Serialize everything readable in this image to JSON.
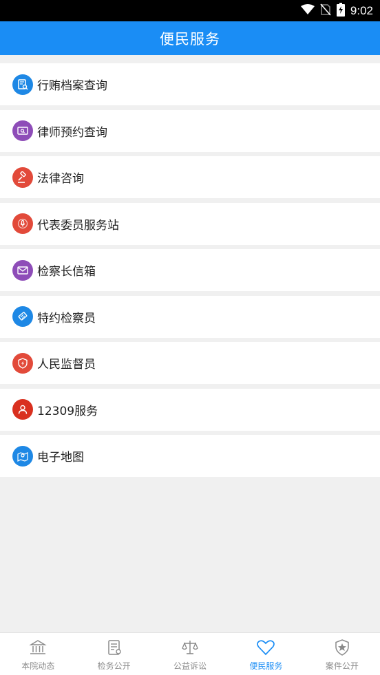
{
  "status_bar": {
    "time": "9:02"
  },
  "header": {
    "title": "便民服务"
  },
  "colors": {
    "accent": "#1a8df5",
    "blue": "#1e88e5",
    "purple": "#8e4db8",
    "red": "#e24a3a",
    "dark_red": "#d9301f"
  },
  "services": [
    {
      "label": "行贿档案查询",
      "icon": "document-search-icon",
      "color": "#1e88e5"
    },
    {
      "label": "律师预约查询",
      "icon": "monitor-search-icon",
      "color": "#8e4db8"
    },
    {
      "label": "法律咨询",
      "icon": "gavel-icon",
      "color": "#e24a3a"
    },
    {
      "label": "代表委员服务站",
      "icon": "microphone-icon",
      "color": "#e24a3a"
    },
    {
      "label": "检察长信箱",
      "icon": "envelope-icon",
      "color": "#8e4db8"
    },
    {
      "label": "特约检察员",
      "icon": "handshake-icon",
      "color": "#1e88e5"
    },
    {
      "label": "人民监督员",
      "icon": "shield-bolt-icon",
      "color": "#e24a3a"
    },
    {
      "label": "12309服务",
      "icon": "person-icon",
      "color": "#d9301f"
    },
    {
      "label": "电子地图",
      "icon": "map-pin-icon",
      "color": "#1e88e5"
    }
  ],
  "tabs": [
    {
      "label": "本院动态",
      "icon": "building-icon",
      "active": false
    },
    {
      "label": "检务公开",
      "icon": "document-icon",
      "active": false
    },
    {
      "label": "公益诉讼",
      "icon": "scales-icon",
      "active": false
    },
    {
      "label": "便民服务",
      "icon": "heart-icon",
      "active": true
    },
    {
      "label": "案件公开",
      "icon": "star-badge-icon",
      "active": false
    }
  ]
}
